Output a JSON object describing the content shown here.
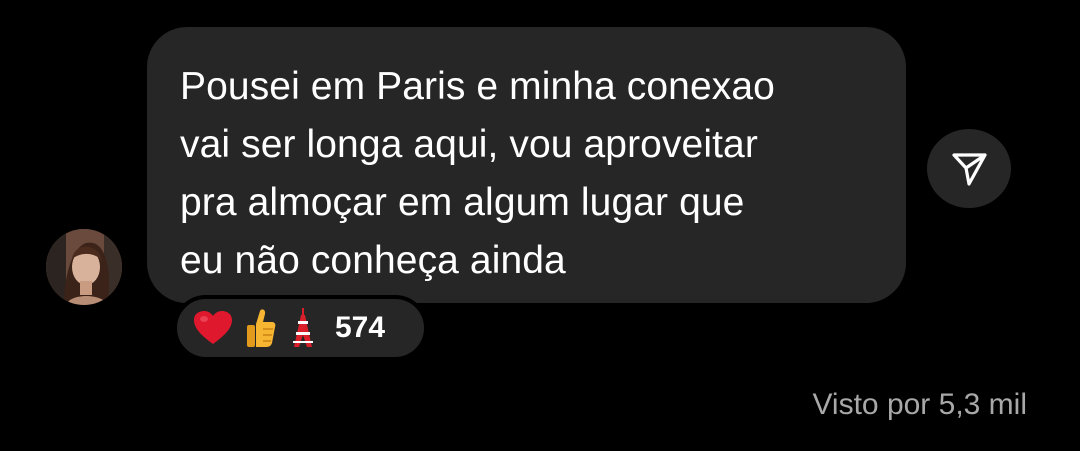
{
  "message": {
    "text": "Pousei em Paris e minha conexao\nvai ser longa aqui, vou aproveitar\npra almoçar em algum lugar que\neu não conheça ainda"
  },
  "reactions": {
    "items": [
      "heart-emoji",
      "thumbs-up-emoji",
      "tokyo-tower-emoji"
    ],
    "count": "574"
  },
  "seen_label": "Visto por 5,3 mil",
  "colors": {
    "background": "#000000",
    "bubble": "#262626",
    "text": "#ffffff",
    "muted": "#a8a8a8",
    "heart": "#e0182d"
  }
}
